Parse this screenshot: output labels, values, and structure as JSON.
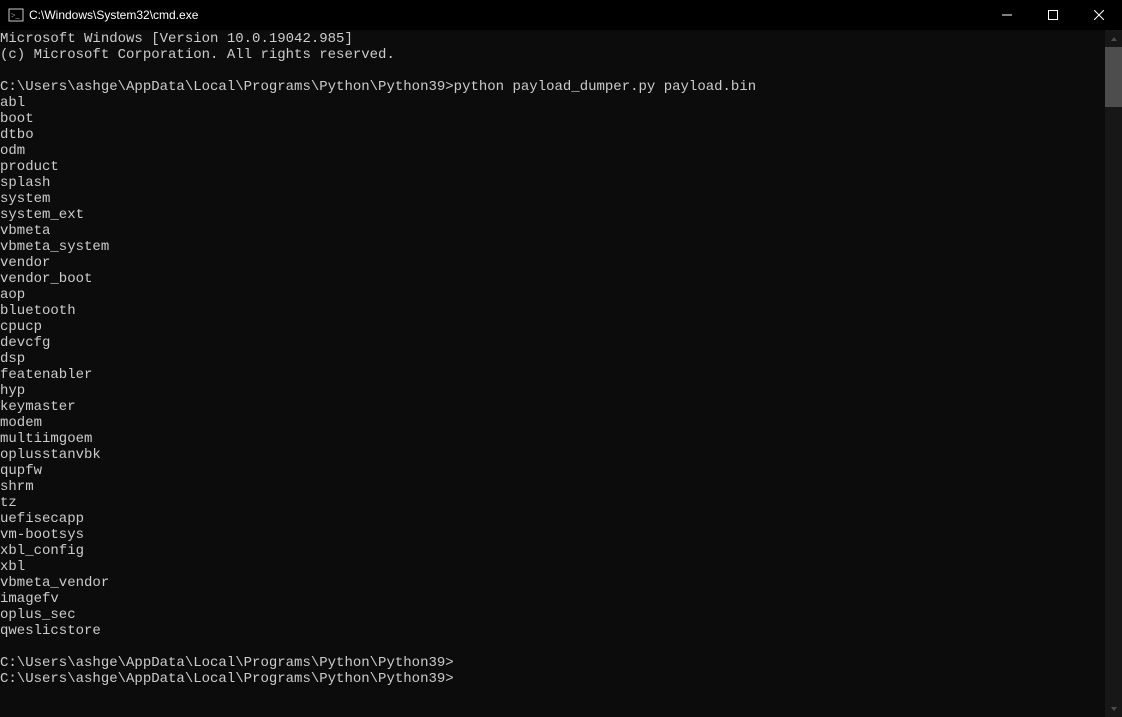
{
  "window": {
    "title": "C:\\Windows\\System32\\cmd.exe"
  },
  "console": {
    "header1": "Microsoft Windows [Version 10.0.19042.985]",
    "header2": "(c) Microsoft Corporation. All rights reserved.",
    "blank": "",
    "prompt1_path": "C:\\Users\\ashge\\AppData\\Local\\Programs\\Python\\Python39>",
    "prompt1_cmd": "python payload_dumper.py payload.bin",
    "output_lines": [
      "abl",
      "boot",
      "dtbo",
      "odm",
      "product",
      "splash",
      "system",
      "system_ext",
      "vbmeta",
      "vbmeta_system",
      "vendor",
      "vendor_boot",
      "aop",
      "bluetooth",
      "cpucp",
      "devcfg",
      "dsp",
      "featenabler",
      "hyp",
      "keymaster",
      "modem",
      "multiimgoem",
      "oplusstanvbk",
      "qupfw",
      "shrm",
      "tz",
      "uefisecapp",
      "vm-bootsys",
      "xbl_config",
      "xbl",
      "vbmeta_vendor",
      "imagefv",
      "oplus_sec",
      "qweslicstore"
    ],
    "prompt2": "C:\\Users\\ashge\\AppData\\Local\\Programs\\Python\\Python39>",
    "prompt3": "C:\\Users\\ashge\\AppData\\Local\\Programs\\Python\\Python39>"
  }
}
